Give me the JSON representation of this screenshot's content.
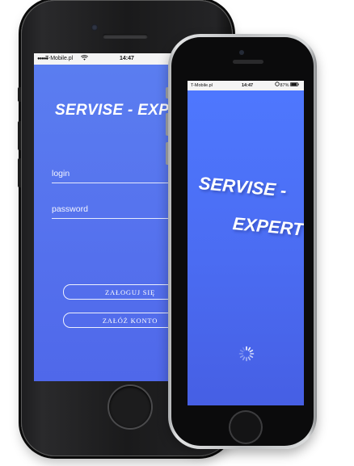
{
  "login_screen": {
    "status_bar": {
      "carrier": "T-Mobile.pl",
      "time": "14:47"
    },
    "brand_title": "SERVISE - EXP",
    "login_placeholder": "login",
    "password_placeholder": "password",
    "login_button_label": "ZAŁOGUJ SIĘ",
    "register_button_label": "ZAŁÓŻ KONTO"
  },
  "splash_screen": {
    "status_bar": {
      "carrier": "T-Mobile.pl",
      "time": "14:47",
      "battery": "87%"
    },
    "brand_line_1": "SERVISE -",
    "brand_line_2": "EXPERT",
    "loading_icon": "spinner-icon"
  },
  "colors": {
    "login_bg": "#5673ee",
    "splash_bg": "#4b6cf2",
    "text": "#ffffff"
  }
}
